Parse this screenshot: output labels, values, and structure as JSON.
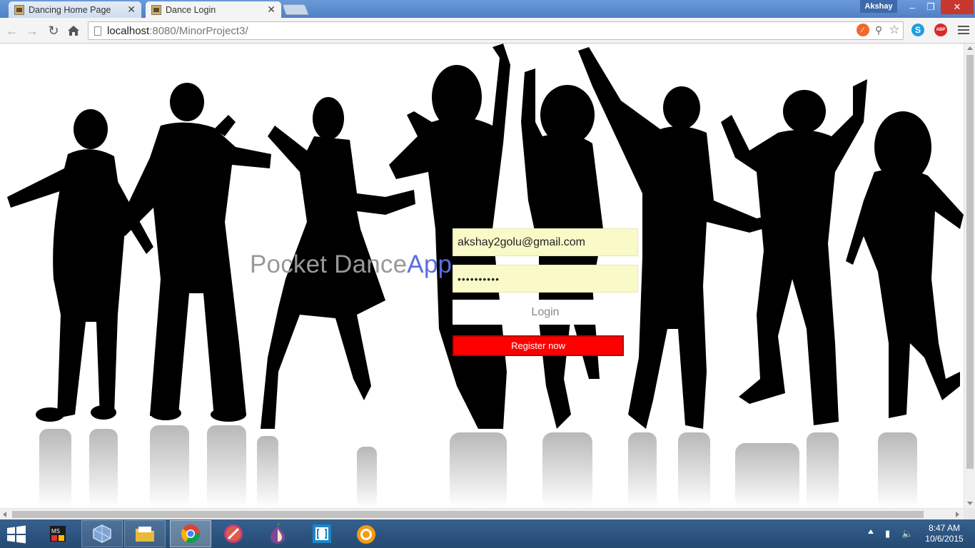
{
  "browser": {
    "tabs": [
      {
        "label": "Dancing Home Page",
        "active": false
      },
      {
        "label": "Dance Login",
        "active": true
      }
    ],
    "profile_name": "Akshay",
    "url_host": "localhost",
    "url_rest": ":8080/MinorProject3/",
    "extensions": [
      "cloudflare-icon",
      "adblock-pin-icon",
      "bookmark-star-icon",
      "skype-icon",
      "adblock-plus-icon"
    ]
  },
  "page": {
    "brand_prefix": "Pocket Dance",
    "brand_accent": "App",
    "email_value": "akshay2golu@gmail.com",
    "password_value": "••••••••••",
    "login_label": "Login",
    "register_label": "Register now"
  },
  "colors": {
    "brand_text": "#999999",
    "brand_accent": "#5a6ee0",
    "input_bg": "#fafac8",
    "register_bg": "#ff0000"
  },
  "taskbar": {
    "apps": [
      "ms-project-icon",
      "virtualbox-icon",
      "file-explorer-icon",
      "chrome-icon",
      "opera-icon",
      "tor-browser-icon",
      "brackets-icon",
      "vlc-icon"
    ],
    "time": "8:47 AM",
    "date": "10/6/2015"
  }
}
